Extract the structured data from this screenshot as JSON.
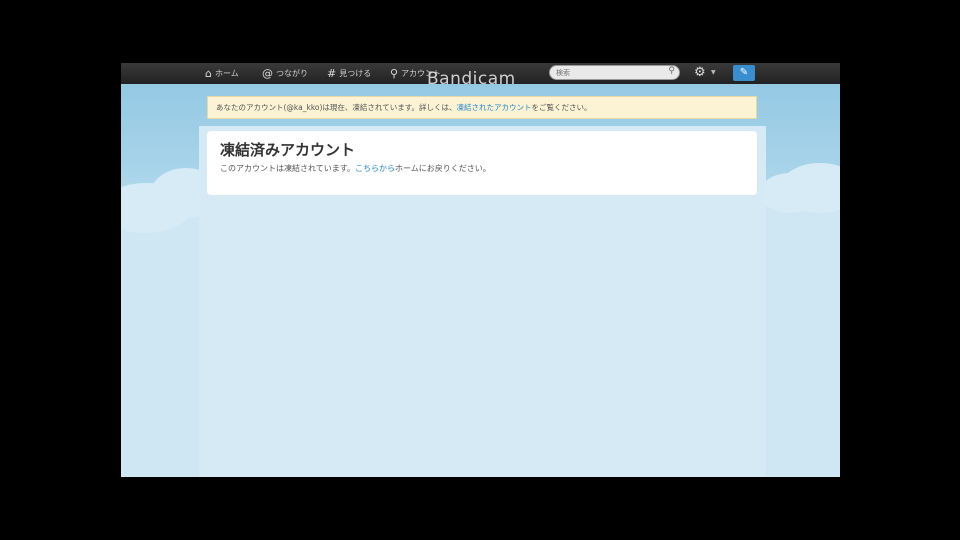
{
  "topbar": {
    "nav": [
      {
        "icon": "home-icon",
        "label": "ホーム"
      },
      {
        "icon": "at-icon",
        "label": "つながり"
      },
      {
        "icon": "hash-icon",
        "label": "見つける"
      },
      {
        "icon": "person-icon",
        "label": "アカウント"
      }
    ],
    "search_placeholder": "検索",
    "watermark": "Bandicam"
  },
  "banner": {
    "text_before": "あなたのアカウント(@ka_kko)は現在、凍結されています。詳しくは、",
    "link": "凍結されたアカウント",
    "text_after": "をご覧ください。"
  },
  "card": {
    "title": "凍結済みアカウント",
    "text_before": "このアカウントは凍結されています。",
    "link": "こちらから",
    "text_after": "ホームにお戻りください。"
  },
  "colors": {
    "topbar": "#2a2a2a",
    "link": "#2a87c9",
    "banner_bg": "#fbf3d4",
    "sky": "#a9d4ea",
    "compose_button": "#3a8ed0"
  }
}
